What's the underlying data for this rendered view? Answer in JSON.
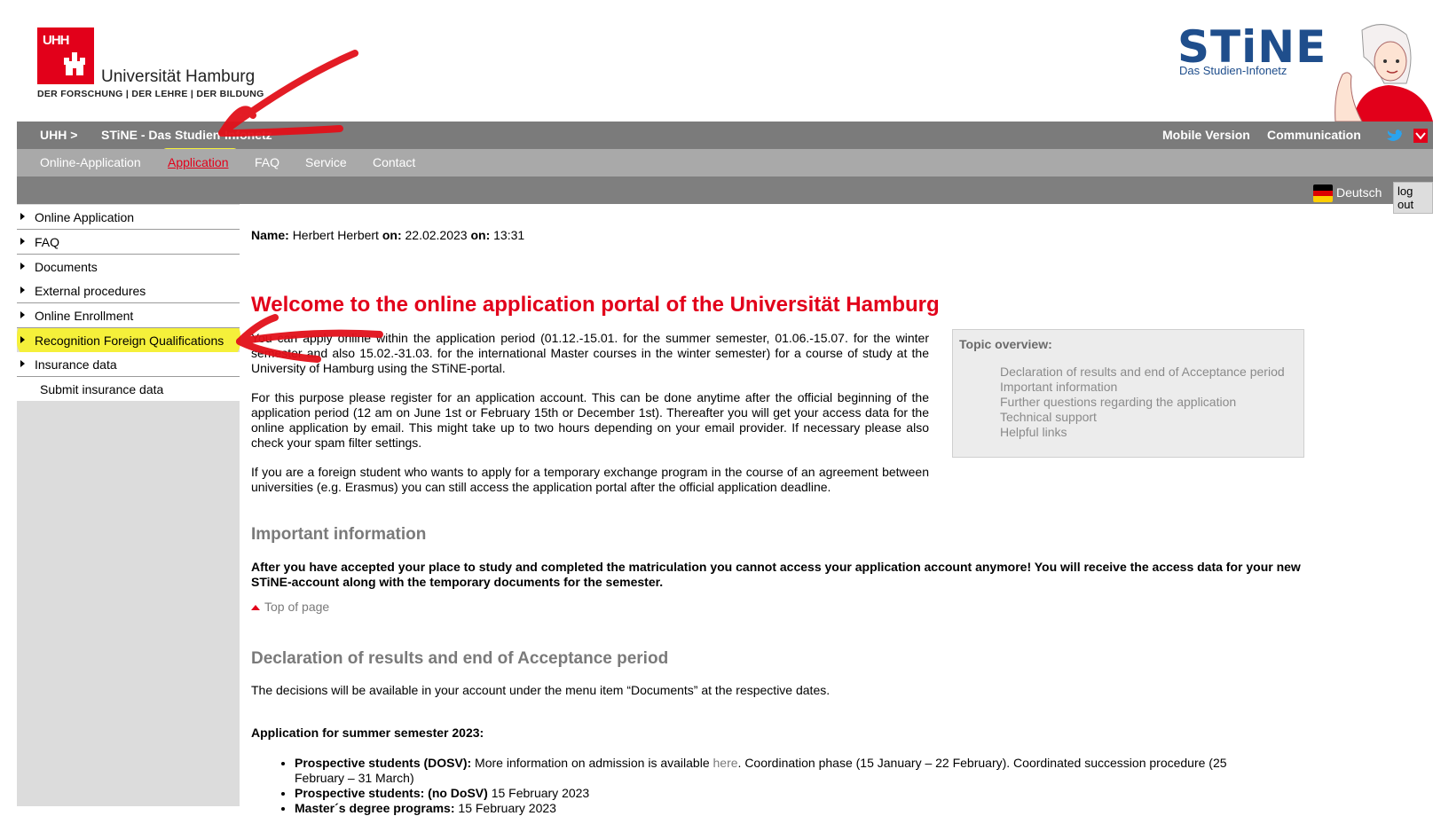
{
  "header": {
    "uhh_logo_text": "UHH",
    "uhh_name": "Universität Hamburg",
    "uhh_tagline": "DER FORSCHUNG | DER LEHRE | DER BILDUNG",
    "stine_logo_text": "STiNE",
    "stine_sub": "Das Studien-Infonetz"
  },
  "topbar": {
    "items": [
      "UHH >",
      "STiNE - Das Studien-Infonetz"
    ],
    "right_items": [
      "Mobile Version",
      "Communication"
    ]
  },
  "nav": {
    "items": [
      "Online-Application",
      "Application",
      "FAQ",
      "Service",
      "Contact"
    ],
    "active": "Application"
  },
  "langbar": {
    "language": "Deutsch",
    "logout": "log out"
  },
  "sidebar": {
    "items": [
      {
        "label": "Online Application"
      },
      {
        "label": "FAQ"
      },
      {
        "label": "Documents"
      },
      {
        "label": "External procedures"
      },
      {
        "label": "Online Enrollment"
      },
      {
        "label": "Recognition Foreign Qualifications"
      },
      {
        "label": "Insurance data"
      }
    ],
    "subitem": "Submit insurance data"
  },
  "content": {
    "name_label": "Name:",
    "name_value": "Herbert Herbert",
    "date_label": "on:",
    "date_value": "22.02.2023",
    "time_label": "on:",
    "time_value": "13:31",
    "welcome": "Welcome to the online application portal of the Universität Hamburg",
    "para1": "You can apply online within the application period (01.12.-15.01. for the summer semester, 01.06.-15.07. for the winter semester and also 15.02.-31.03. for the international Master courses in the winter semester) for a course of study at the University of Hamburg using the STiNE-portal.",
    "para2": "For this purpose please register for an application account. This can be done anytime after the official beginning of the application period (12 am on June 1st or February 15th or December 1st). Thereafter you will get your access data for the online application by email. This might take up to two hours depending on your email provider. If necessary please also check your spam filter settings.",
    "para3": "If you are a foreign student who wants to apply for a temporary exchange program in the course of an agreement between universities (e.g. Erasmus) you can still access the application portal after the official application deadline.",
    "important_heading": "Important information",
    "important_text": "After you have accepted your place to study and completed the matriculation you cannot access your application account anymore! You will receive the access data for your new STiNE-account along with the temporary documents for the semester.",
    "top_of_page": "Top of page",
    "declaration_heading": "Declaration of results and end of Acceptance period",
    "declaration_text": "The decisions will be available in your account under the menu item “Documents” at the respective dates.",
    "summer_heading": "Application for summer semester 2023:",
    "bullets": [
      {
        "bold": "Prospective students (DOSV):",
        "text1": " More information on admission is available ",
        "link": "here",
        "text2": ". Coordination phase (15 January – 22 February). Coordinated succession procedure (25 February – 31 March)"
      },
      {
        "bold": "Prospective students: (no DoSV)",
        "text1": " 15 February 2023",
        "link": "",
        "text2": ""
      },
      {
        "bold": "Master´s degree programs:",
        "text1": " 15 February 2023",
        "link": "",
        "text2": ""
      }
    ]
  },
  "topic_overview": {
    "title": "Topic overview:",
    "links": [
      "Declaration of results and end of Acceptance period",
      "Important information",
      "Further questions regarding the application",
      "Technical support",
      "Helpful links"
    ]
  },
  "colors": {
    "accent": "#e2001a",
    "highlight": "#f5f03a",
    "navy": "#1f4e8c"
  }
}
